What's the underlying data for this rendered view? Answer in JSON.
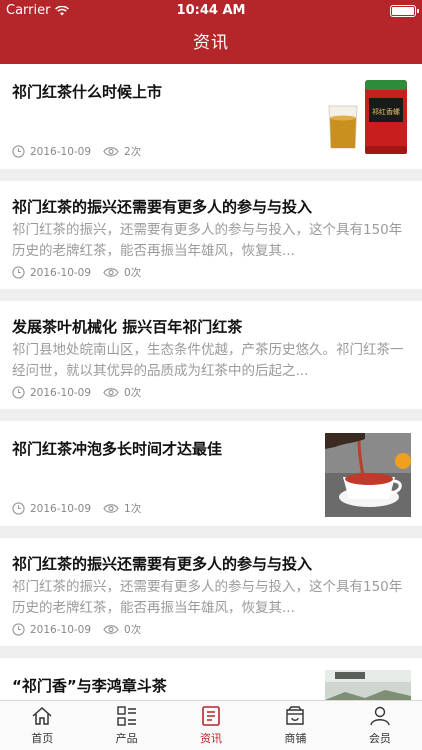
{
  "status": {
    "carrier": "Carrier",
    "time": "10:44 AM"
  },
  "nav": {
    "title": "资讯"
  },
  "articles": [
    {
      "title": "祁门红茶什么时候上市",
      "date": "2016-10-09",
      "views": "2次",
      "has_image": true,
      "image": "tea-tin-and-glass"
    },
    {
      "title": "祁门红茶的振兴还需要有更多人的参与与投入",
      "summary": "祁门红茶的振兴，还需要有更多人的参与与投入，这个具有150年历史的老牌红茶，能否再振当年雄风，恢复其...",
      "date": "2016-10-09",
      "views": "0次"
    },
    {
      "title": "发展茶叶机械化 振兴百年祁门红茶",
      "summary": "祁门县地处皖南山区，生态条件优越，产茶历史悠久。祁门红茶一经问世，就以其优异的品质成为红茶中的后起之...",
      "date": "2016-10-09",
      "views": "0次"
    },
    {
      "title": "祁门红茶冲泡多长时间才达最佳",
      "date": "2016-10-09",
      "views": "1次",
      "has_image": true,
      "image": "tea-pouring-into-cup"
    },
    {
      "title": "祁门红茶的振兴还需要有更多人的参与与投入",
      "summary": "祁门红茶的振兴，还需要有更多人的参与与投入，这个具有150年历史的老牌红茶，能否再振当年雄风，恢复其...",
      "date": "2016-10-09",
      "views": "0次"
    },
    {
      "title": "“祁门香”与李鸿章斗茶",
      "has_image": true,
      "image": "tea-garden-landscape"
    }
  ],
  "product_label": "祁红香螺",
  "tabs": [
    {
      "label": "首页",
      "icon": "home-icon"
    },
    {
      "label": "产品",
      "icon": "product-grid-icon"
    },
    {
      "label": "资讯",
      "icon": "news-icon",
      "active": true
    },
    {
      "label": "商铺",
      "icon": "shop-icon"
    },
    {
      "label": "会员",
      "icon": "user-icon"
    }
  ],
  "colors": {
    "brand": "#b5262b",
    "muted": "#9b9b9b"
  }
}
